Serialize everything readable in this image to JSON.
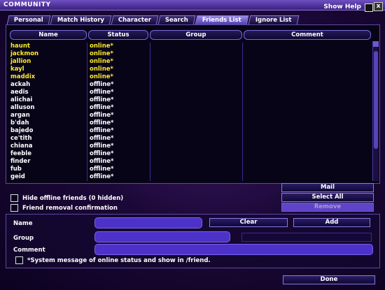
{
  "window": {
    "title": "COMMUNITY",
    "show_help": "Show Help",
    "close": "x"
  },
  "tabs": [
    "Personal",
    "Match History",
    "Character",
    "Search",
    "Friends List",
    "Ignore List"
  ],
  "active_tab": "Friends List",
  "columns": [
    "Name",
    "Status",
    "Group",
    "Comment"
  ],
  "friends": [
    {
      "name": "haunt",
      "status": "online*"
    },
    {
      "name": "jackmon",
      "status": "online*"
    },
    {
      "name": "jallion",
      "status": "online*"
    },
    {
      "name": "kayl",
      "status": "online*"
    },
    {
      "name": "maddix",
      "status": "online*"
    },
    {
      "name": "ackah",
      "status": "offline*"
    },
    {
      "name": "aedis",
      "status": "offline*"
    },
    {
      "name": "alichai",
      "status": "offline*"
    },
    {
      "name": "alluson",
      "status": "offline*"
    },
    {
      "name": "argan",
      "status": "offline*"
    },
    {
      "name": "b'dah",
      "status": "offline*"
    },
    {
      "name": "bajedo",
      "status": "offline*"
    },
    {
      "name": "ce'tith",
      "status": "offline*"
    },
    {
      "name": "chiana",
      "status": "offline*"
    },
    {
      "name": "feeble",
      "status": "offline*"
    },
    {
      "name": "finder",
      "status": "offline*"
    },
    {
      "name": "fub",
      "status": "offline*"
    },
    {
      "name": "geid",
      "status": "offline*"
    }
  ],
  "options": {
    "hide_offline": "Hide offline friends (0 hidden)",
    "removal_confirm": "Friend removal confirmation",
    "system_message": "*System message of online status and show in /friend."
  },
  "actions": {
    "mail": "Mail",
    "select_all": "Select All",
    "remove": "Remove"
  },
  "form": {
    "name_label": "Name",
    "group_label": "Group",
    "comment_label": "Comment",
    "clear": "Clear",
    "add": "Add"
  },
  "done": "Done",
  "colors": {
    "online": "#ffec2a",
    "offline": "#ffffff",
    "accent": "#5f44c8"
  }
}
